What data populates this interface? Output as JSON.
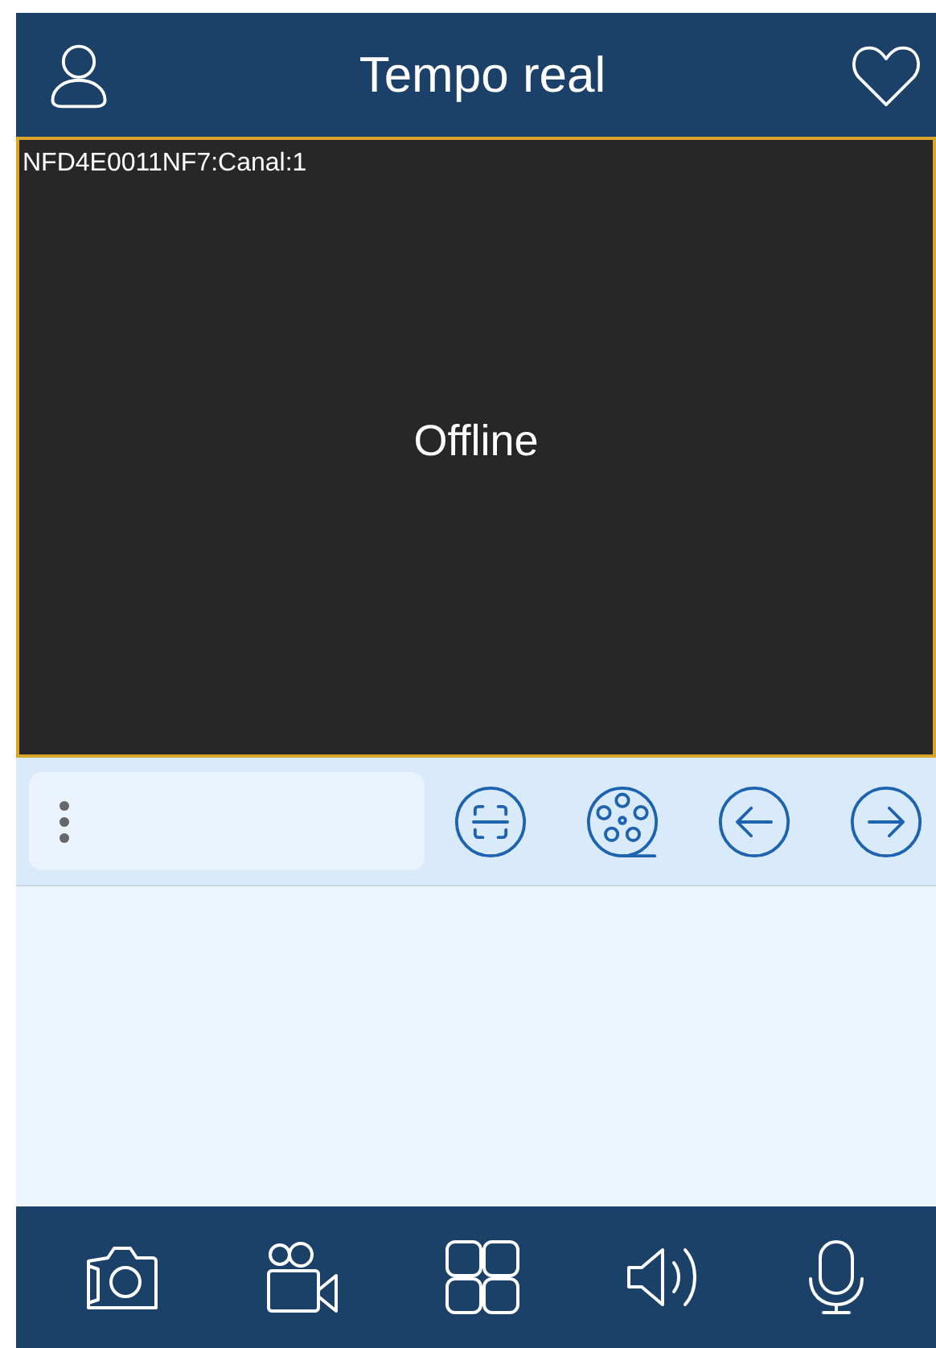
{
  "header": {
    "title": "Tempo real",
    "left_button": {
      "kind": "user"
    },
    "right_button": {
      "kind": "heart"
    }
  },
  "video_tile": {
    "channel_label": "NFD4E0011NF7:Canal:1",
    "status": "Offline",
    "selected": true
  },
  "controls": [
    {
      "kind": "more"
    },
    {
      "kind": "scan"
    },
    {
      "kind": "reel"
    },
    {
      "kind": "prev"
    },
    {
      "kind": "next"
    }
  ],
  "bottom_bar": [
    {
      "kind": "snapshot"
    },
    {
      "kind": "record"
    },
    {
      "kind": "grid"
    },
    {
      "kind": "sound"
    },
    {
      "kind": "mic"
    }
  ]
}
